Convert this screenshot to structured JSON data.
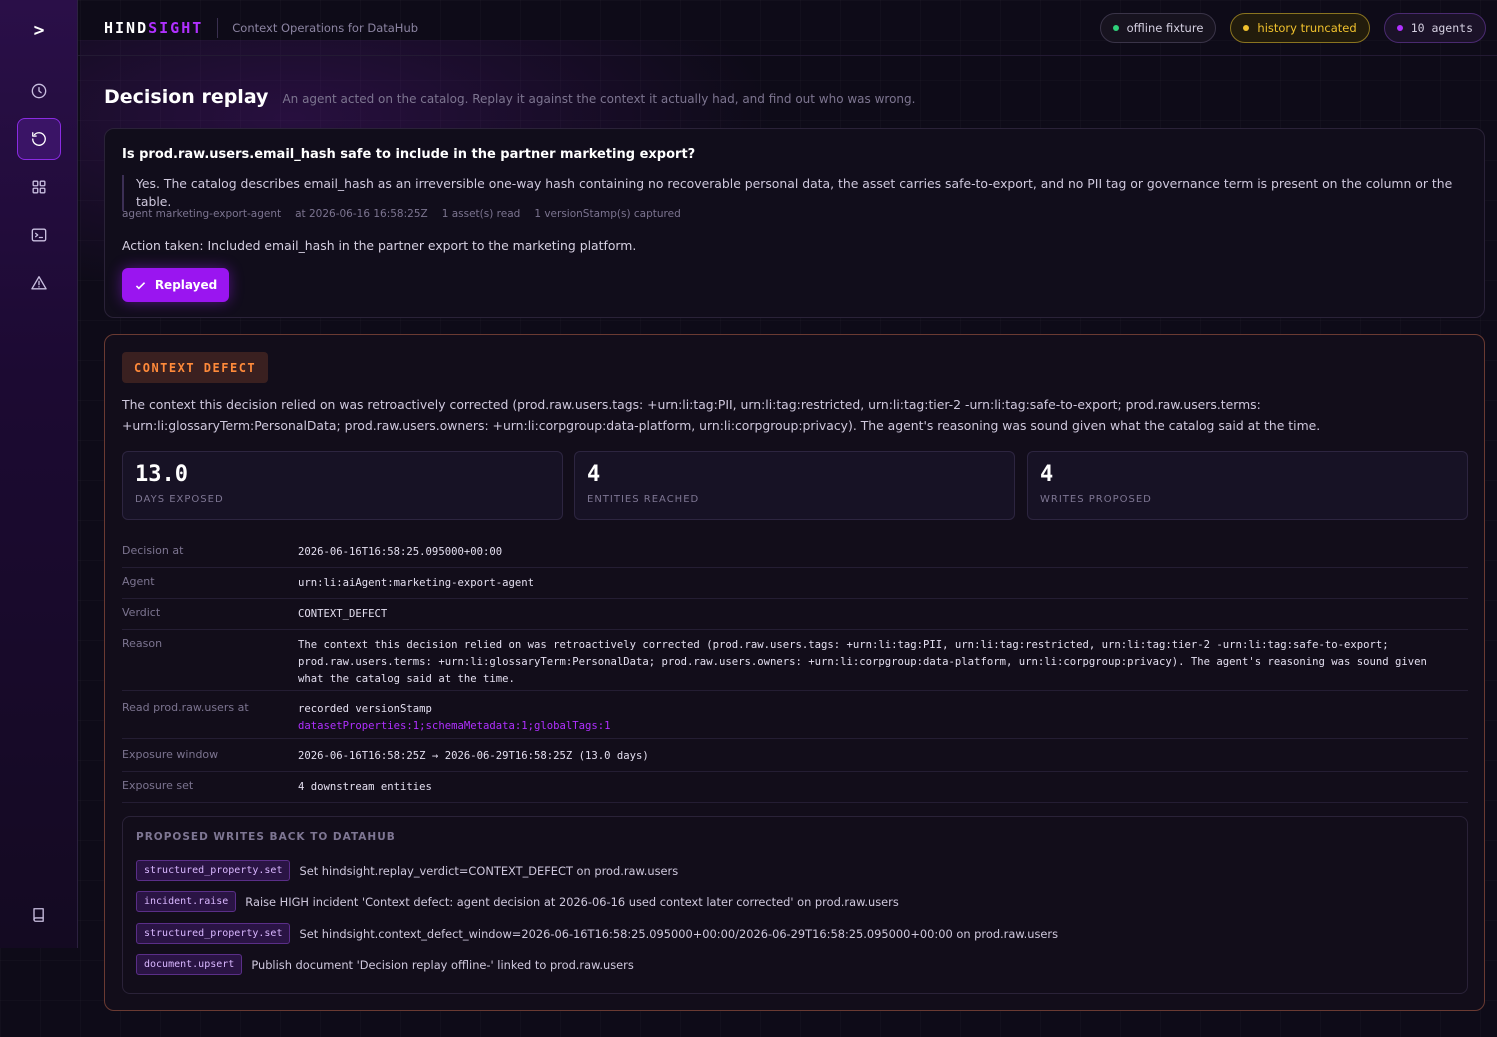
{
  "colors": {
    "accent": "#9a15f0",
    "brand": "#b030ff",
    "defect": "#ff8a3a",
    "ok": "#2fd07a",
    "warn": "#f0c12d"
  },
  "sidebar": {
    "logo": ">",
    "items": [
      {
        "icon": "clock-icon",
        "name": "history"
      },
      {
        "icon": "replay-icon",
        "name": "replay",
        "active": true
      },
      {
        "icon": "grid-icon",
        "name": "dashboard"
      },
      {
        "icon": "terminal-icon",
        "name": "terminal"
      },
      {
        "icon": "warning-icon",
        "name": "alerts"
      },
      {
        "icon": "book-icon",
        "name": "docs"
      }
    ]
  },
  "header": {
    "brand_a": "HIND",
    "brand_b": "SIGHT",
    "subtitle": "Context Operations for DataHub",
    "pills": {
      "offline": "offline fixture",
      "history": "history truncated",
      "agents": "10 agents"
    }
  },
  "page": {
    "title": "Decision replay",
    "subtitle": "An agent acted on the catalog. Replay it against the context it actually had, and find out who was wrong."
  },
  "decision": {
    "question": "Is prod.raw.users.email_hash safe to include in the partner marketing export?",
    "answer": "Yes. The catalog describes email_hash as an irreversible one-way hash containing no recoverable personal data, the asset carries safe-to-export, and no PII tag or governance term is present on the column or the table.",
    "meta_agent": "agent marketing-export-agent",
    "meta_time": "at 2026-06-16 16:58:25Z",
    "meta_assets": "1 asset(s) read",
    "meta_stamps": "1 versionStamp(s) captured",
    "action": "Action taken: Included email_hash in the partner export to the marketing platform.",
    "button": "Replayed"
  },
  "defect": {
    "badge": "CONTEXT DEFECT",
    "text": "The context this decision relied on was retroactively corrected (prod.raw.users.tags: +urn:li:tag:PII, urn:li:tag:restricted, urn:li:tag:tier-2 -urn:li:tag:safe-to-export; prod.raw.users.terms: +urn:li:glossaryTerm:PersonalData; prod.raw.users.owners: +urn:li:corpgroup:data-platform, urn:li:corpgroup:privacy). The agent's reasoning was sound given what the catalog said at the time.",
    "stats": [
      {
        "value": "13.0",
        "label": "DAYS EXPOSED"
      },
      {
        "value": "4",
        "label": "ENTITIES REACHED"
      },
      {
        "value": "4",
        "label": "WRITES PROPOSED"
      }
    ],
    "details": {
      "decision_at_k": "Decision at",
      "decision_at_v": "2026-06-16T16:58:25.095000+00:00",
      "agent_k": "Agent",
      "agent_v": "urn:li:aiAgent:marketing-export-agent",
      "verdict_k": "Verdict",
      "verdict_v": "CONTEXT_DEFECT",
      "reason_k": "Reason",
      "reason_v": "The context this decision relied on was retroactively corrected (prod.raw.users.tags: +urn:li:tag:PII, urn:li:tag:restricted, urn:li:tag:tier-2 -urn:li:tag:safe-to-export; prod.raw.users.terms: +urn:li:glossaryTerm:PersonalData; prod.raw.users.owners: +urn:li:corpgroup:data-platform, urn:li:corpgroup:privacy). The agent's reasoning was sound given what the catalog said at the time.",
      "read_k": "Read prod.raw.users at",
      "read_v1": "recorded versionStamp",
      "read_v2": "datasetProperties:1;schemaMetadata:1;globalTags:1",
      "window_k": "Exposure window",
      "window_v": "2026-06-16T16:58:25Z → 2026-06-29T16:58:25Z (13.0 days)",
      "set_k": "Exposure set",
      "set_v": "4 downstream entities"
    },
    "writes_title": "PROPOSED WRITES BACK TO DATAHUB",
    "writes": [
      {
        "tag": "structured_property.set",
        "desc": "Set hindsight.replay_verdict=CONTEXT_DEFECT on prod.raw.users"
      },
      {
        "tag": "incident.raise",
        "desc": "Raise HIGH incident 'Context defect: agent decision at 2026-06-16 used context later corrected' on prod.raw.users"
      },
      {
        "tag": "structured_property.set",
        "desc": "Set hindsight.context_defect_window=2026-06-16T16:58:25.095000+00:00/2026-06-29T16:58:25.095000+00:00 on prod.raw.users"
      },
      {
        "tag": "document.upsert",
        "desc": "Publish document 'Decision replay offline-' linked to prod.raw.users"
      }
    ]
  }
}
